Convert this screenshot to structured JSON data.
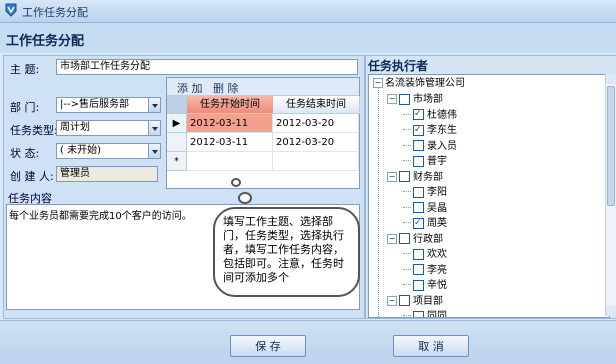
{
  "window": {
    "title": "工作任务分配"
  },
  "header": {
    "title": "工作任务分配"
  },
  "form": {
    "subject_label": "主    题:",
    "subject_value": "市场部工作任务分配",
    "dept_label": "部    门:",
    "dept_value": "|-->售后服务部",
    "type_label": "任务类型:",
    "type_value": "周计划",
    "status_label": "状    态:",
    "status_value": "( 未开始)",
    "creator_label": "创 建 人:",
    "creator_value": "管理员",
    "content_label": "任务内容",
    "content_value": "每个业务员都需要完成10个客户的访问。"
  },
  "grid": {
    "add_label": "添 加",
    "delete_label": "删 除",
    "columns": [
      "任务开始时间",
      "任务结束时间"
    ],
    "rows": [
      [
        "2012-03-11",
        "2012-03-20"
      ],
      [
        "2012-03-11",
        "2012-03-20"
      ]
    ],
    "current_marker": "▶",
    "new_marker": "*"
  },
  "callout": {
    "text": "填写工作主题、选择部门，任务类型，选择执行者，填写工作任务内容，包括即可。注意，任务时间可添加多个"
  },
  "tree": {
    "title": "任务执行者",
    "root": "名流装饰管理公司",
    "nodes": [
      {
        "label": "市场部",
        "level": 1,
        "type": "dept",
        "checked": false
      },
      {
        "label": "杜德伟",
        "level": 2,
        "type": "user",
        "checked": true
      },
      {
        "label": "李东生",
        "level": 2,
        "type": "user",
        "checked": true
      },
      {
        "label": "录入员",
        "level": 2,
        "type": "user",
        "checked": false
      },
      {
        "label": "普宇",
        "level": 2,
        "type": "user",
        "checked": false
      },
      {
        "label": "财务部",
        "level": 1,
        "type": "dept",
        "checked": false
      },
      {
        "label": "李阳",
        "level": 2,
        "type": "user",
        "checked": false
      },
      {
        "label": "吴晶",
        "level": 2,
        "type": "user",
        "checked": false
      },
      {
        "label": "周英",
        "level": 2,
        "type": "user",
        "checked": true
      },
      {
        "label": "行政部",
        "level": 1,
        "type": "dept",
        "checked": false
      },
      {
        "label": "欢欢",
        "level": 2,
        "type": "user",
        "checked": false
      },
      {
        "label": "李亮",
        "level": 2,
        "type": "user",
        "checked": false
      },
      {
        "label": "辛悦",
        "level": 2,
        "type": "user",
        "checked": false
      },
      {
        "label": "项目部",
        "level": 1,
        "type": "dept",
        "checked": false
      },
      {
        "label": "同同",
        "level": 2,
        "type": "user",
        "checked": false
      }
    ]
  },
  "footer": {
    "save_label": "保  存",
    "cancel_label": "取  消"
  }
}
